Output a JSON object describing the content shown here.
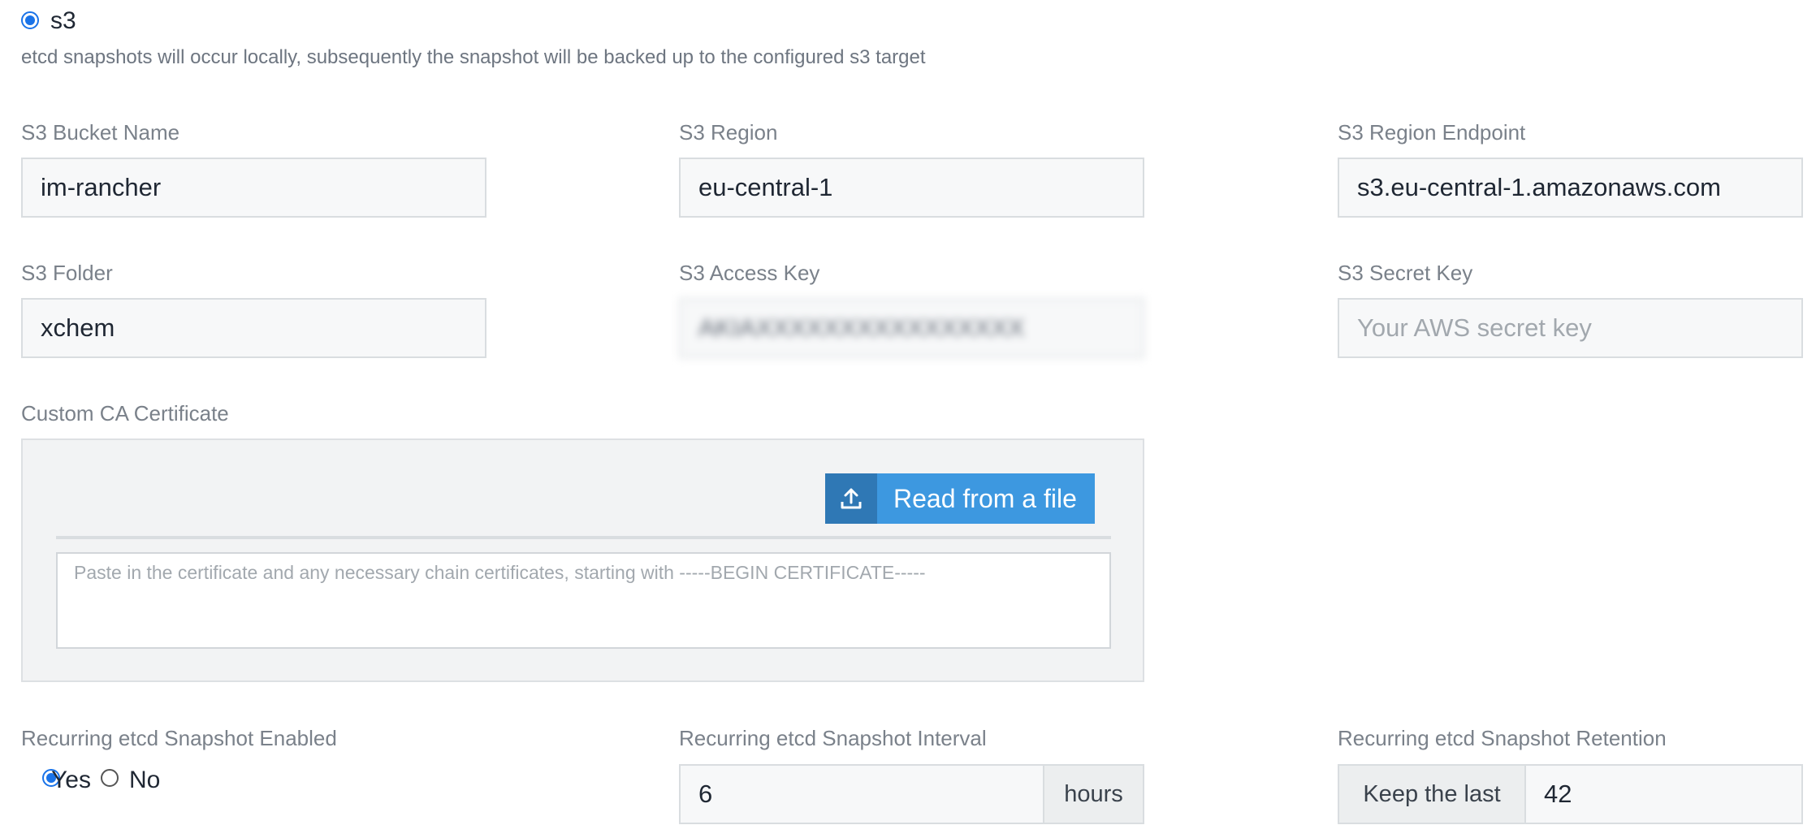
{
  "s3_option": {
    "label": "s3",
    "description": "etcd snapshots will occur locally, subsequently the snapshot will be backed up to the configured s3 target"
  },
  "fields": {
    "bucket_name": {
      "label": "S3 Bucket Name",
      "value": "im-rancher"
    },
    "region": {
      "label": "S3 Region",
      "value": "eu-central-1"
    },
    "region_endpoint": {
      "label": "S3 Region Endpoint",
      "value": "s3.eu-central-1.amazonaws.com"
    },
    "folder": {
      "label": "S3 Folder",
      "value": "xchem"
    },
    "access_key": {
      "label": "S3 Access Key",
      "value": "AKIAXXXXXXXXXXXXXXXX"
    },
    "secret_key": {
      "label": "S3 Secret Key",
      "value": "",
      "placeholder": "Your AWS secret key"
    }
  },
  "custom_ca": {
    "label": "Custom CA Certificate",
    "read_button_label": "Read from a file",
    "placeholder": "Paste in the certificate and any necessary chain certificates, starting with -----BEGIN CERTIFICATE-----"
  },
  "recurring": {
    "enabled_label": "Recurring etcd Snapshot Enabled",
    "yes_label": "Yes",
    "no_label": "No",
    "selected": "Yes",
    "interval_label": "Recurring etcd Snapshot Interval",
    "interval_value": "6",
    "interval_unit": "hours",
    "retention_label": "Recurring etcd Snapshot Retention",
    "retention_prefix": "Keep the last",
    "retention_value": "42"
  },
  "colors": {
    "accent": "#1a73e8",
    "button": "#3d98e0",
    "button_icon_bg": "#2f78b5"
  },
  "icons": {
    "upload": "upload-icon"
  }
}
